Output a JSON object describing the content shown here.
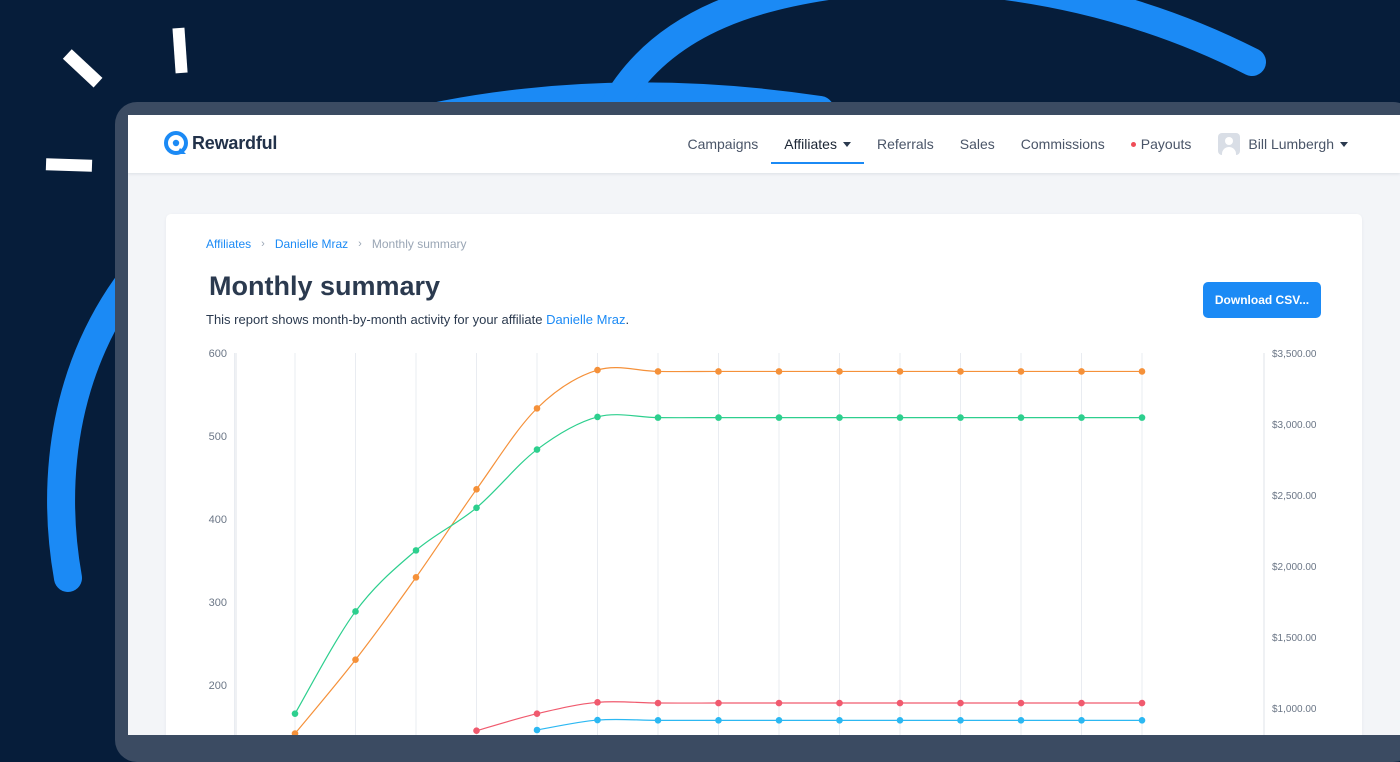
{
  "app": {
    "brand": "Rewardful",
    "accent": "#1b8af5"
  },
  "nav": {
    "items": [
      {
        "label": "Campaigns",
        "active": false
      },
      {
        "label": "Affiliates",
        "active": true,
        "dropdown": true
      },
      {
        "label": "Referrals",
        "active": false
      },
      {
        "label": "Sales",
        "active": false
      },
      {
        "label": "Commissions",
        "active": false
      },
      {
        "label": "Payouts",
        "active": false,
        "indicator": "red-dot"
      }
    ],
    "user": "Bill Lumbergh"
  },
  "breadcrumb": {
    "items": [
      "Affiliates",
      "Danielle Mraz"
    ],
    "current": "Monthly summary"
  },
  "page": {
    "title": "Monthly summary",
    "subtitle_prefix": "This report shows month-by-month activity for your affiliate ",
    "subtitle_link": "Danielle Mraz",
    "subtitle_suffix": ".",
    "download_label": "Download CSV..."
  },
  "chart_data": {
    "type": "line",
    "left_axis": {
      "ticks": [
        "600",
        "500",
        "400",
        "300",
        "200"
      ],
      "range": [
        100,
        600
      ]
    },
    "right_axis": {
      "ticks": [
        "$3,500.00",
        "$3,000.00",
        "$2,500.00",
        "$2,000.00",
        "$1,500.00",
        "$1,000.00"
      ],
      "range": [
        750,
        3500
      ]
    },
    "x_count": 17,
    "grid": "vertical",
    "series": [
      {
        "color": "#f5913a",
        "axis": "right",
        "values": [
          null,
          null,
          820,
          1340,
          1920,
          2540,
          3110,
          3380,
          3370,
          3370,
          3370,
          3370,
          3370,
          3370,
          3370,
          3370,
          3370
        ]
      },
      {
        "color": "#2dcf8e",
        "axis": "right",
        "values": [
          null,
          null,
          960,
          1680,
          2110,
          2410,
          2820,
          3050,
          3045,
          3045,
          3045,
          3045,
          3045,
          3045,
          3045,
          3045,
          3045
        ]
      },
      {
        "color": "#f05a6e",
        "axis": "right",
        "values": [
          null,
          null,
          null,
          null,
          null,
          840,
          960,
          1040,
          1035,
          1035,
          1035,
          1035,
          1035,
          1035,
          1035,
          1035,
          1035
        ]
      },
      {
        "color": "#2cb8f2",
        "axis": "right",
        "values": [
          null,
          null,
          null,
          null,
          null,
          null,
          845,
          915,
          913,
          913,
          913,
          913,
          913,
          913,
          913,
          913,
          913
        ]
      }
    ]
  }
}
